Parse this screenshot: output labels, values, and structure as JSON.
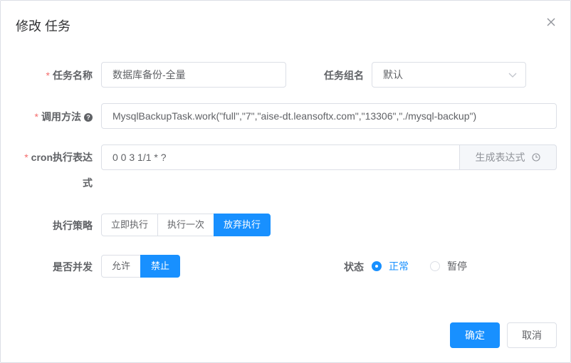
{
  "dialog": {
    "title": "修改 任务"
  },
  "form": {
    "job_name": {
      "required_mark": "*",
      "label": "任务名称",
      "value": "数据库备份-全量"
    },
    "job_group": {
      "label": "任务组名",
      "value": "默认"
    },
    "invoke_target": {
      "required_mark": "*",
      "label": "调用方法",
      "help": "?",
      "value": "MysqlBackupTask.work(\"full\",\"7\",\"aise-dt.leansoftx.com\",\"13306\",\"./mysql-backup\")"
    },
    "cron": {
      "required_mark": "*",
      "label_line1": "cron执行表达",
      "label_line2": "式",
      "value": "0 0 3 1/1 * ?",
      "generate_label": "生成表达式"
    },
    "misfire_policy": {
      "label": "执行策略",
      "options": [
        "立即执行",
        "执行一次",
        "放弃执行"
      ],
      "selected": "放弃执行"
    },
    "concurrent": {
      "label": "是否并发",
      "options": [
        "允许",
        "禁止"
      ],
      "selected": "禁止"
    },
    "status": {
      "label": "状态",
      "options": [
        "正常",
        "暂停"
      ],
      "selected": "正常"
    }
  },
  "footer": {
    "confirm_label": "确定",
    "cancel_label": "取消"
  },
  "colors": {
    "primary": "#1890ff",
    "required": "#f56c6c",
    "border": "#dcdfe6"
  },
  "icons": {
    "close": "close-icon",
    "select_arrow": "chevron-down-icon",
    "clock": "clock-icon",
    "help": "question-circle-icon"
  }
}
